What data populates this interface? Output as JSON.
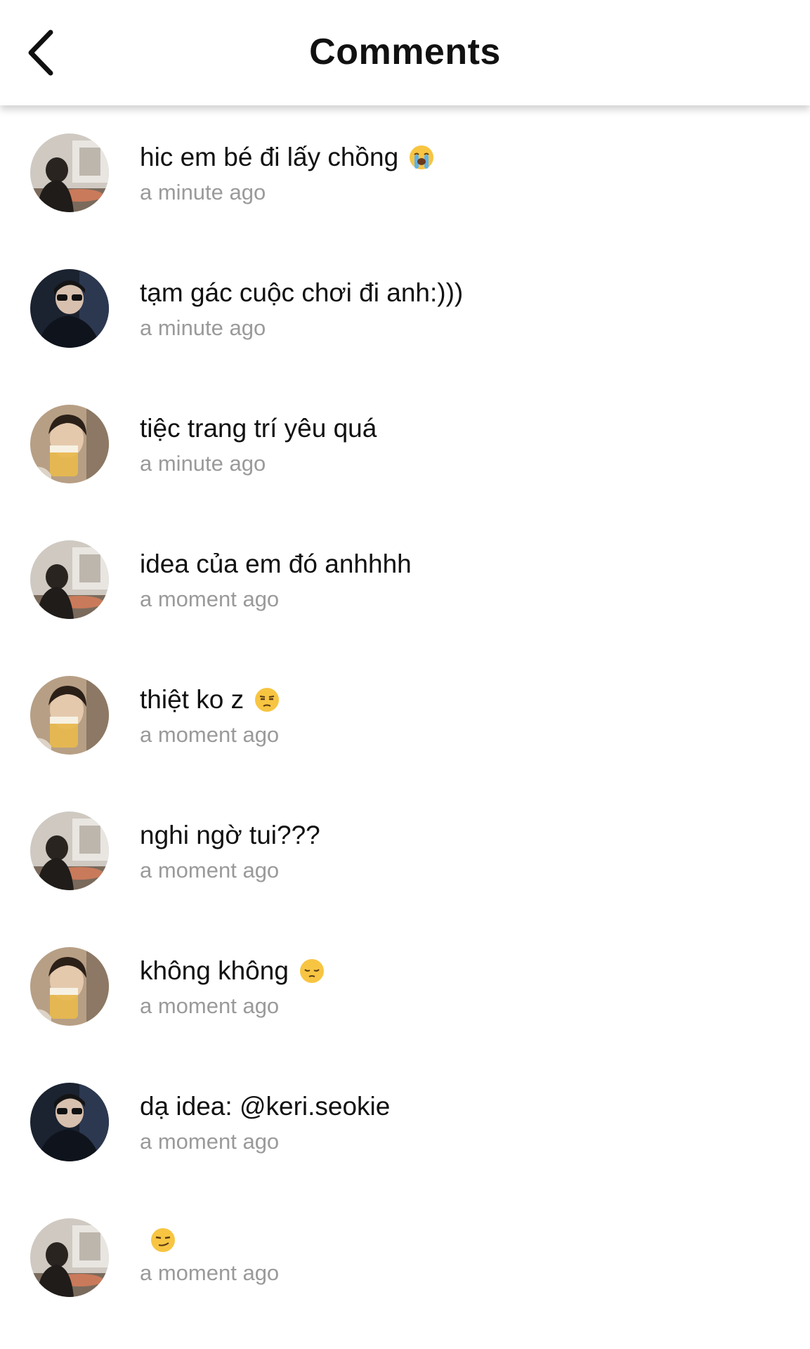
{
  "header": {
    "title": "Comments",
    "back_icon": "chevron-left-icon"
  },
  "comments": [
    {
      "text": "hic em bé đi lấy chồng",
      "emoji": "loudly-crying-face",
      "time": "a minute ago",
      "avatar": "avatar-a"
    },
    {
      "text": "tạm gác cuộc chơi đi anh:)))",
      "emoji": "",
      "time": "a minute ago",
      "avatar": "avatar-b"
    },
    {
      "text": "tiệc trang trí yêu quá",
      "emoji": "",
      "time": "a minute ago",
      "avatar": "avatar-c"
    },
    {
      "text": "idea của em đó anhhhh",
      "emoji": "",
      "time": "a moment ago",
      "avatar": "avatar-a"
    },
    {
      "text": "thiệt ko z",
      "emoji": "unamused-face",
      "time": "a moment ago",
      "avatar": "avatar-c"
    },
    {
      "text": "nghi ngờ tui???",
      "emoji": "",
      "time": "a moment ago",
      "avatar": "avatar-a"
    },
    {
      "text": "không không",
      "emoji": "pensive-face",
      "time": "a moment ago",
      "avatar": "avatar-c"
    },
    {
      "text": "dạ idea: @keri.seokie",
      "emoji": "",
      "time": "a moment ago",
      "avatar": "avatar-b"
    },
    {
      "text": "",
      "emoji": "smirking-face",
      "time": "a moment ago",
      "avatar": "avatar-a"
    }
  ]
}
